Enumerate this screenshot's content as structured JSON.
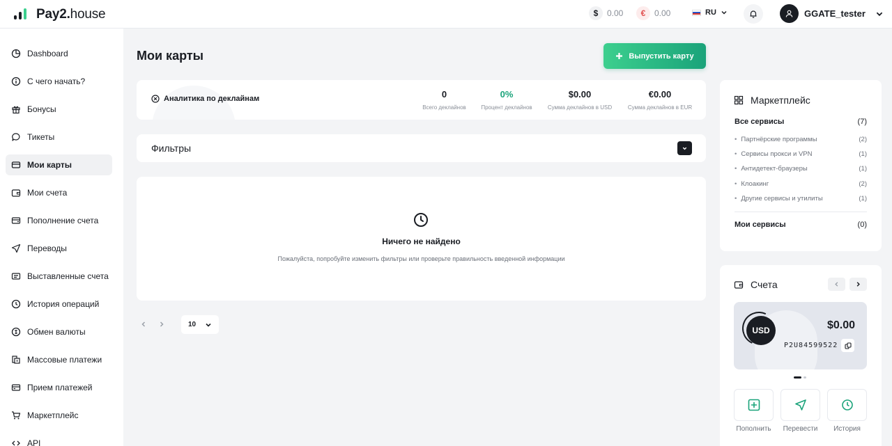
{
  "header": {
    "logo_bold": "Pay2.",
    "logo_light": "house",
    "balance_usd": "0.00",
    "balance_eur": "0.00",
    "usd_symbol": "$",
    "eur_symbol": "€",
    "language": "RU",
    "username": "GGATE_tester"
  },
  "sidebar": {
    "items": [
      {
        "label": "Dashboard",
        "icon": "chart-pie-icon"
      },
      {
        "label": "С чего начать?",
        "icon": "info-icon"
      },
      {
        "label": "Бонусы",
        "icon": "gift-icon"
      },
      {
        "label": "Тикеты",
        "icon": "chat-icon"
      },
      {
        "label": "Мои карты",
        "icon": "card-icon",
        "active": true
      },
      {
        "label": "Мои счета",
        "icon": "wallet-icon"
      },
      {
        "label": "Пополнение счета",
        "icon": "deposit-icon"
      },
      {
        "label": "Переводы",
        "icon": "send-icon"
      },
      {
        "label": "Выставленные счета",
        "icon": "invoice-icon"
      },
      {
        "label": "История операций",
        "icon": "history-icon"
      },
      {
        "label": "Обмен валюты",
        "icon": "exchange-icon"
      },
      {
        "label": "Массовые платежи",
        "icon": "mass-payments-icon"
      },
      {
        "label": "Прием платежей",
        "icon": "receive-icon"
      },
      {
        "label": "Маркетплейс",
        "icon": "cart-icon"
      },
      {
        "label": "API",
        "icon": "api-icon"
      }
    ]
  },
  "main": {
    "title": "Мои карты",
    "issue_button": "Выпустить карту",
    "analytics": {
      "title": "Аналитика по деклайнам",
      "stats": [
        {
          "value": "0",
          "label": "Всего деклайнов"
        },
        {
          "value": "0%",
          "label": "Процент деклайнов"
        },
        {
          "value": "$0.00",
          "label": "Сумма деклайнов в USD"
        },
        {
          "value": "€0.00",
          "label": "Сумма деклайнов в EUR"
        }
      ]
    },
    "filters_title": "Фильтры",
    "empty": {
      "title": "Ничего не найдено",
      "description": "Пожалуйста, попробуйте изменить фильтры или проверьте правильность введенной информации"
    },
    "per_page": "10"
  },
  "marketplace": {
    "title": "Маркетплейс",
    "all_label": "Все сервисы",
    "all_count": "(7)",
    "categories": [
      {
        "label": "Партнёрские программы",
        "count": "(2)"
      },
      {
        "label": "Сервисы прокси и VPN",
        "count": "(1)"
      },
      {
        "label": "Антидетект-браузеры",
        "count": "(1)"
      },
      {
        "label": "Клоакинг",
        "count": "(2)"
      },
      {
        "label": "Другие сервисы и утилиты",
        "count": "(1)"
      }
    ],
    "my_label": "Мои сервисы",
    "my_count": "(0)"
  },
  "accounts": {
    "title": "Счета",
    "currency": "USD",
    "amount": "$0.00",
    "number": "P2U84599522",
    "actions": [
      "Пополнить",
      "Перевести",
      "История"
    ]
  },
  "colors": {
    "accent": "#1aa37a",
    "accent_light": "#3ccf8e",
    "dark": "#1a1d23"
  }
}
